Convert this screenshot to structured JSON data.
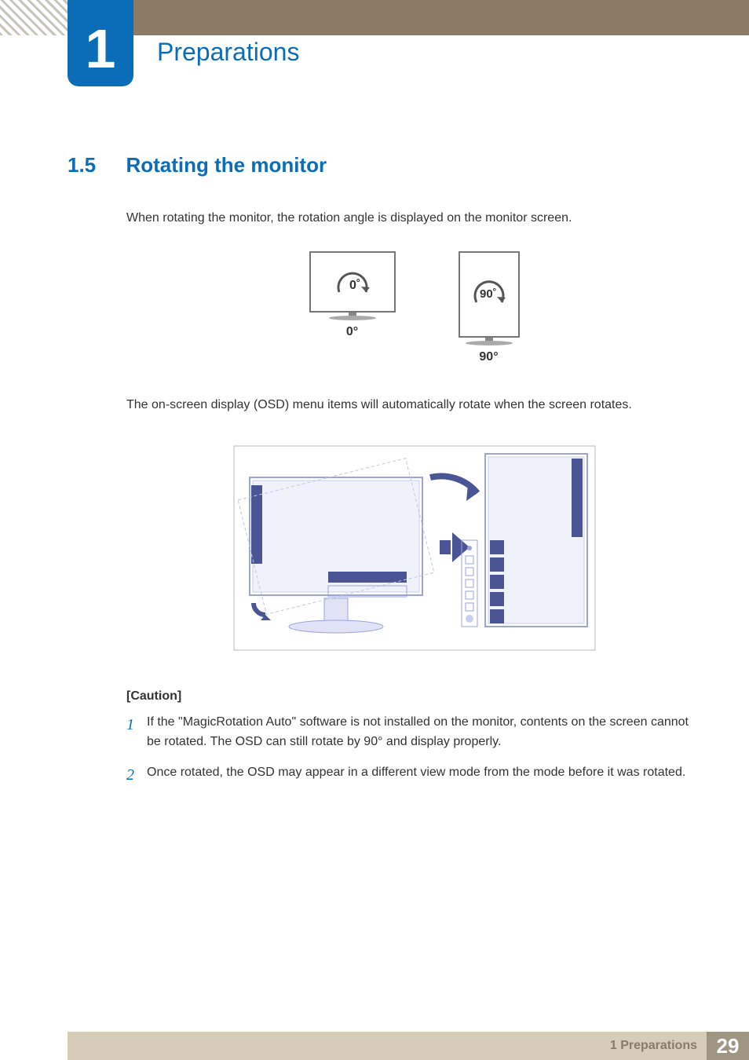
{
  "chapter": {
    "number": "1",
    "title": "Preparations"
  },
  "section": {
    "number": "1.5",
    "title": "Rotating the monitor"
  },
  "paragraphs": {
    "intro": "When rotating the monitor, the rotation angle is displayed on the monitor screen.",
    "osd_note": "The on-screen display (OSD) menu items will automatically rotate when the screen rotates."
  },
  "figure1": {
    "angle_a_inside": "0˚",
    "angle_a_label": "0°",
    "angle_b_inside": "90˚",
    "angle_b_label": "90°"
  },
  "caution": {
    "label": "[Caution]",
    "items": [
      {
        "num": "1",
        "text": "If the  \"MagicRotation Auto\"  software is not installed on the monitor, contents on the screen cannot be rotated. The OSD can still rotate by 90° and display properly."
      },
      {
        "num": "2",
        "text": "Once rotated, the OSD may appear in a different view mode from the mode before it was rotated."
      }
    ]
  },
  "footer": {
    "text": "1 Preparations",
    "page": "29"
  }
}
